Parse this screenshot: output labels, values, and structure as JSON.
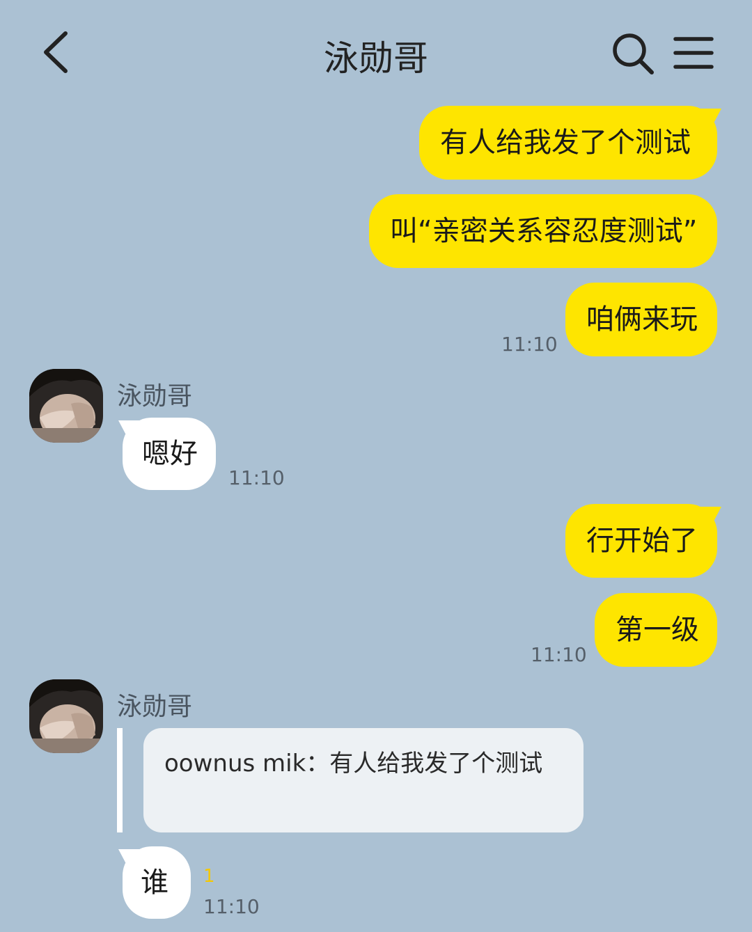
{
  "header": {
    "title": "泳勋哥",
    "back_icon": "chevron-left-icon",
    "search_icon": "search-icon",
    "menu_icon": "menu-icon"
  },
  "colors": {
    "background": "#abc1d3",
    "my_bubble": "#fee500",
    "their_bubble": "#ffffff",
    "unread": "#f5c800"
  },
  "messages": {
    "m1": "有人给我发了个测试",
    "m2": "叫“亲密关系容忍度测试”",
    "m3": "咱俩来玩",
    "m3_time": "11:10",
    "contact1_name": "泳勋哥",
    "r1": "嗯好",
    "r1_time": "11:10",
    "m4": "行开始了",
    "m5": "第一级",
    "m5_time": "11:10",
    "contact2_name": "泳勋哥",
    "quote_text": "oownus mik：有人给我发了个测试",
    "r2": "谁",
    "r2_unread": "1",
    "r2_time": "11:10"
  }
}
